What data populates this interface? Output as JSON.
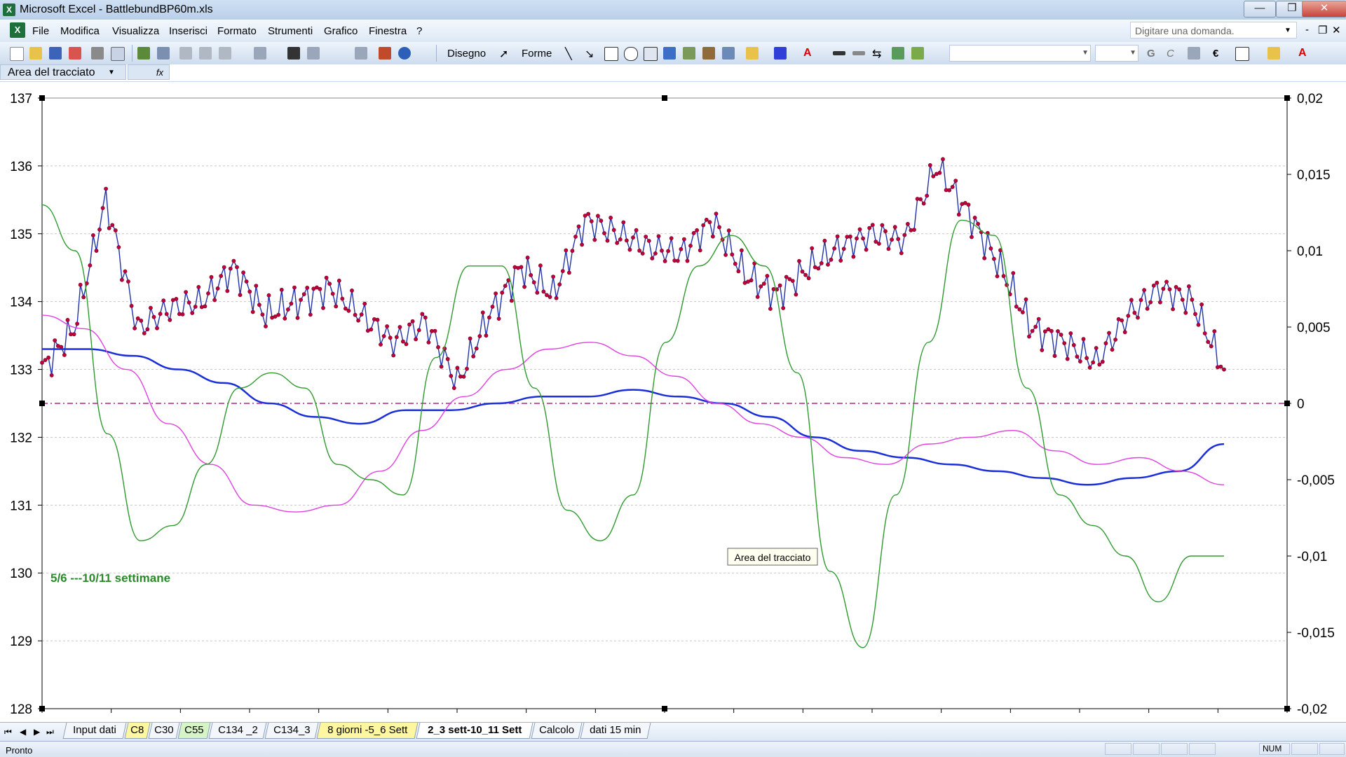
{
  "window": {
    "title": "Microsoft Excel - BattlebundBP60m.xls",
    "minimize": "—",
    "restore": "❐",
    "close": "✕"
  },
  "menu": {
    "items": [
      "File",
      "Modifica",
      "Visualizza",
      "Inserisci",
      "Formato",
      "Strumenti",
      "Grafico",
      "Finestra",
      "?"
    ],
    "help_placeholder": "Digitare una domanda.",
    "mdi_minimize": "-",
    "mdi_restore": "❐",
    "mdi_close": "✕"
  },
  "toolbar": {
    "drawing_label": "Disegno",
    "shapes_label": "Forme",
    "euro": "€"
  },
  "namebox": {
    "value": "Area del tracciato",
    "fx": "fx"
  },
  "chart_data": {
    "type": "line",
    "title": "",
    "annotation": "5/6 ---10/11 settimane",
    "tooltip": "Area del tracciato",
    "ylim": [
      128,
      137
    ],
    "y2lim": [
      -0.02,
      0.02
    ],
    "left_ticks": [
      "128",
      "129",
      "130",
      "131",
      "132",
      "133",
      "134",
      "135",
      "136",
      "137"
    ],
    "right_ticks": [
      "-0,02",
      "-0,015",
      "-0,01",
      "-0,005",
      "0",
      "0,005",
      "0,01",
      "0,015",
      "0,02"
    ],
    "x": [
      0,
      5,
      10,
      15,
      20,
      25,
      30,
      35,
      40,
      45,
      50,
      55,
      60,
      65,
      70,
      75,
      80,
      85,
      90,
      95,
      100,
      105,
      110,
      115,
      120,
      125,
      130,
      135,
      140,
      145,
      150,
      155,
      160,
      165,
      170,
      175,
      180,
      181
    ],
    "series": [
      {
        "color": "#c0003c",
        "axis": "left",
        "markers": true,
        "values": [
          133.0,
          133.6,
          135.5,
          133.6,
          133.9,
          134.0,
          134.5,
          133.8,
          134.0,
          134.2,
          133.8,
          133.4,
          133.7,
          132.8,
          133.8,
          134.5,
          134.1,
          135.2,
          135.0,
          134.8,
          134.7,
          135.2,
          134.4,
          134.1,
          134.5,
          134.8,
          135.0,
          134.9,
          136.0,
          135.3,
          134.5,
          133.6,
          133.4,
          133.1,
          133.8,
          134.2,
          134.0,
          133.0
        ]
      },
      {
        "color": "#1a2fd8",
        "axis": "left",
        "markers": false,
        "values": [
          133.3,
          133.3,
          133.2,
          133.0,
          132.8,
          132.5,
          132.3,
          132.2,
          132.4,
          132.4,
          132.5,
          132.6,
          132.6,
          132.7,
          132.6,
          132.5,
          132.3,
          132.0,
          131.8,
          131.7,
          131.6,
          131.5,
          131.4,
          131.3,
          131.4,
          131.5,
          131.9
        ]
      },
      {
        "color": "#e040e0",
        "axis": "left",
        "markers": false,
        "values": [
          133.8,
          133.6,
          133.0,
          132.2,
          131.6,
          131.0,
          130.9,
          131.0,
          131.5,
          132.1,
          132.6,
          133.0,
          133.3,
          133.4,
          133.2,
          132.9,
          132.5,
          132.2,
          132.0,
          131.7,
          131.6,
          131.9,
          132.0,
          132.1,
          131.8,
          131.6,
          131.7,
          131.5,
          131.3
        ]
      },
      {
        "color": "#2f9a2f",
        "axis": "right",
        "markers": false,
        "values": [
          0.013,
          0.01,
          -0.002,
          -0.009,
          -0.008,
          -0.004,
          0.001,
          0.002,
          0.001,
          -0.004,
          -0.005,
          -0.006,
          0.003,
          0.009,
          0.009,
          0.001,
          -0.007,
          -0.009,
          -0.006,
          0.004,
          0.009,
          0.011,
          0.009,
          0.002,
          -0.011,
          -0.016,
          -0.006,
          0.004,
          0.012,
          0.011,
          0.001,
          -0.006,
          -0.008,
          -0.01,
          -0.013,
          -0.01,
          -0.01
        ]
      }
    ]
  },
  "sheets": {
    "tabs": [
      "Input dati",
      "C8",
      "C30",
      "C55",
      "C134 _2",
      "C134_3",
      "8 giorni -5_6 Sett",
      "2_3 sett-10_11 Sett",
      "Calcolo",
      "dati 15 min"
    ],
    "active": "2_3 sett-10_11 Sett"
  },
  "status": {
    "text": "Pronto",
    "num": "NUM"
  }
}
